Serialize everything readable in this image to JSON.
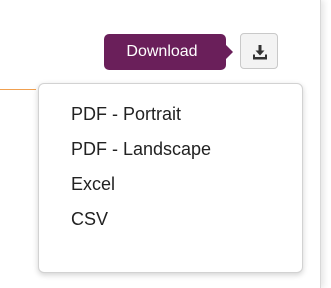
{
  "tooltip": {
    "text": "Download"
  },
  "download_button": {
    "icon": "download-icon"
  },
  "menu": {
    "items": [
      {
        "label": "PDF - Portrait"
      },
      {
        "label": "PDF - Landscape"
      },
      {
        "label": "Excel"
      },
      {
        "label": "CSV"
      }
    ]
  },
  "colors": {
    "tooltip_bg": "#6a1f5a",
    "accent_rule": "#f0a050",
    "button_bg": "#f3f3f3",
    "icon": "#333333"
  }
}
